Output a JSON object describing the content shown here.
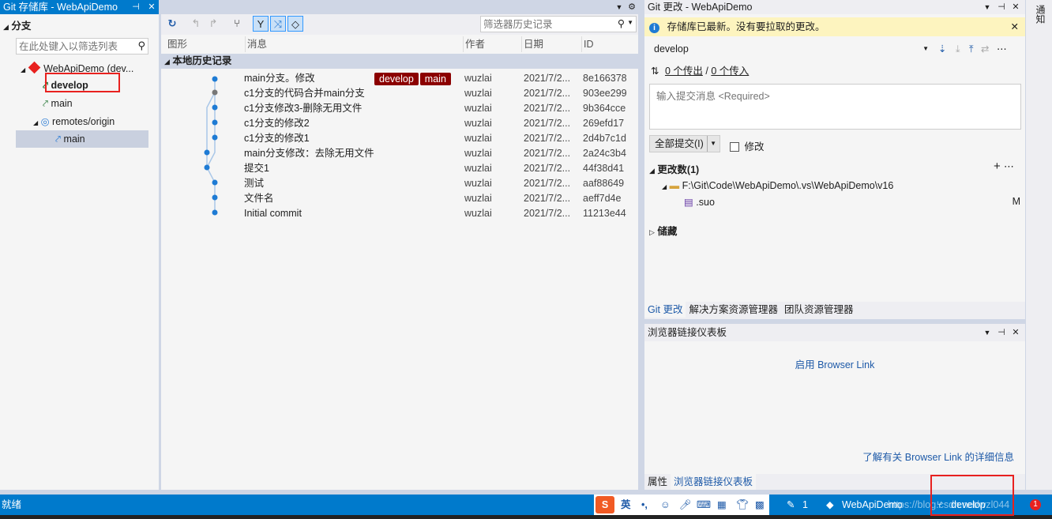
{
  "git_repo": {
    "title": "Git 存储库 - WebApiDemo",
    "branches_header": "分支",
    "filter_placeholder": "在此处键入以筛选列表",
    "repo_name": "WebApiDemo (dev...",
    "branches": [
      "develop",
      "main"
    ],
    "remotes_label": "remotes/origin",
    "remote_branch": "main"
  },
  "history": {
    "filter_placeholder": "筛选器历史记录",
    "columns": [
      "图形",
      "消息",
      "作者",
      "日期",
      "ID"
    ],
    "section": "本地历史记录",
    "tag_develop": "develop",
    "tag_main": "main",
    "commits": [
      {
        "message": "main分支。修改",
        "author": "wuzlai",
        "date": "2021/7/2...",
        "id": "8e166378"
      },
      {
        "message": "c1分支的代码合并main分支",
        "author": "wuzlai",
        "date": "2021/7/2...",
        "id": "903ee299"
      },
      {
        "message": "c1分支修改3-删除无用文件",
        "author": "wuzlai",
        "date": "2021/7/2...",
        "id": "9b364cce"
      },
      {
        "message": "c1分支的修改2",
        "author": "wuzlai",
        "date": "2021/7/2...",
        "id": "269efd17"
      },
      {
        "message": "c1分支的修改1",
        "author": "wuzlai",
        "date": "2021/7/2...",
        "id": "2d4b7c1d"
      },
      {
        "message": "main分支修改：去除无用文件",
        "author": "wuzlai",
        "date": "2021/7/2...",
        "id": "2a24c3b4"
      },
      {
        "message": "提交1",
        "author": "wuzlai",
        "date": "2021/7/2...",
        "id": "44f38d41"
      },
      {
        "message": "测试",
        "author": "wuzlai",
        "date": "2021/7/2...",
        "id": "aaf88649"
      },
      {
        "message": "文件名",
        "author": "wuzlai",
        "date": "2021/7/2...",
        "id": "aeff7d4e"
      },
      {
        "message": "Initial commit",
        "author": "wuzlai",
        "date": "2021/7/2...",
        "id": "11213e44"
      }
    ]
  },
  "git_changes": {
    "title": "Git 更改 - WebApiDemo",
    "info": "存储库已最新。没有要拉取的更改。",
    "branch": "develop",
    "outgoing": "0 个传出",
    "sep": " / ",
    "incoming": "0 个传入",
    "commit_placeholder": "输入提交消息 <Required>",
    "commit_all": "全部提交(I)",
    "amend": "修改",
    "changes_header": "更改数(1)",
    "folder_path": "F:\\Git\\Code\\WebApiDemo\\.vs\\WebApiDemo\\v16",
    "file_name": ".suo",
    "file_status": "M",
    "stash": "储藏",
    "tabs": [
      "Git 更改",
      "解决方案资源管理器",
      "团队资源管理器"
    ]
  },
  "browser_link": {
    "title": "浏览器链接仪表板",
    "enable": "启用 Browser Link",
    "learn_more": "了解有关 Browser Link 的详细信息",
    "tabs": [
      "属性",
      "浏览器链接仪表板"
    ]
  },
  "side_tab": "通知",
  "status_bar": {
    "ready": "就绪",
    "ime_lang": "英",
    "ime_punct": "•,",
    "edits": "1",
    "repo": "WebApiDemo",
    "branch": "develop",
    "watermark": "https://blog.csdn.net/wzl044",
    "count": "1"
  },
  "colors": {
    "accent": "#007acc",
    "tag": "#8b0000",
    "annotation": "#e8211f",
    "info": "#fdf4bf"
  }
}
